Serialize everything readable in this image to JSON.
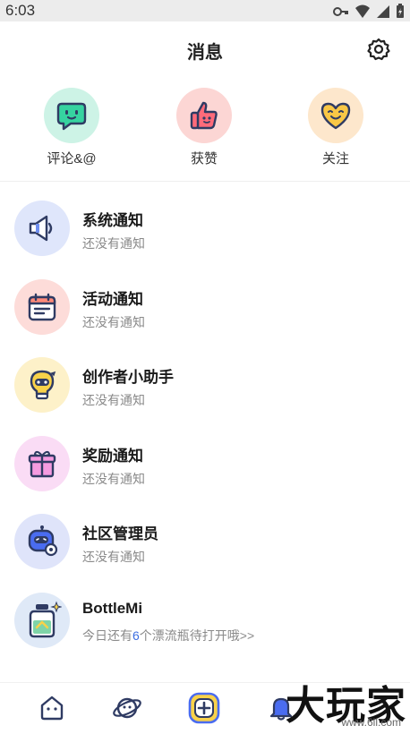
{
  "status": {
    "time": "6:03"
  },
  "header": {
    "title": "消息"
  },
  "quick": [
    {
      "label": "评论&@",
      "icon": "comment-face-icon",
      "bg": "#cdf3e6"
    },
    {
      "label": "获赞",
      "icon": "thumbs-up-icon",
      "bg": "#fcd6d4"
    },
    {
      "label": "关注",
      "icon": "heart-face-icon",
      "bg": "#fde7cc"
    }
  ],
  "list": [
    {
      "title": "系统通知",
      "sub": "还没有通知",
      "icon": "megaphone-icon",
      "bg": "#dfe6fb"
    },
    {
      "title": "活动通知",
      "sub": "还没有通知",
      "icon": "calendar-icon",
      "bg": "#fddcd9"
    },
    {
      "title": "创作者小助手",
      "sub": "还没有通知",
      "icon": "bulb-helper-icon",
      "bg": "#fdf1c9"
    },
    {
      "title": "奖励通知",
      "sub": "还没有通知",
      "icon": "gift-icon",
      "bg": "#fadcf5"
    },
    {
      "title": "社区管理员",
      "sub": "还没有通知",
      "icon": "admin-bot-icon",
      "bg": "#dfe4fa"
    },
    {
      "title": "BottleMi",
      "sub_pre": "今日还有",
      "sub_num": "6",
      "sub_post": "个漂流瓶待打开哦>>",
      "icon": "bottle-icon",
      "bg": "#dfe9f7"
    }
  ],
  "nav": [
    {
      "icon": "home-icon"
    },
    {
      "icon": "planet-icon"
    },
    {
      "icon": "add-post-icon"
    },
    {
      "icon": "bell-icon"
    }
  ],
  "watermark": {
    "text": "大玩家",
    "sub": "www.6ll.com"
  },
  "colors": {
    "accent": "#3b6de0",
    "yellow": "#f9d24a",
    "outline": "#2f3b63"
  }
}
